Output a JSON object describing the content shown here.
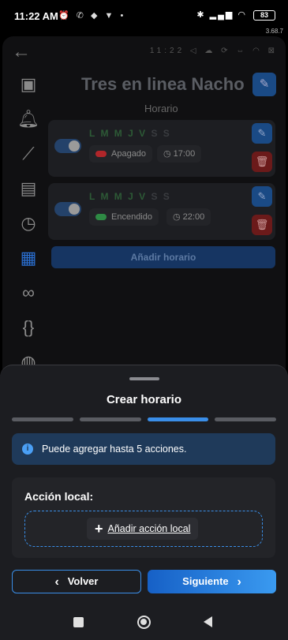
{
  "status_bar": {
    "time": "11:22 AM",
    "battery": "83",
    "version": "3.68.7"
  },
  "background": {
    "mini_time": "11:22",
    "device_title": "Tres en linea Nacho",
    "subtitle": "Horario",
    "add_schedule_label": "Añadir horario",
    "schedules": [
      {
        "days_on": "L M M J V",
        "days_off": "S S",
        "state": "Apagado",
        "state_color": "#b0262a",
        "time": "17:00",
        "enabled": true
      },
      {
        "days_on": "L M M J V",
        "days_off": "S S",
        "state": "Encendido",
        "state_color": "#2e8a44",
        "time": "22:00",
        "enabled": true
      }
    ]
  },
  "sheet": {
    "title": "Crear horario",
    "steps_total": 4,
    "current_step": 3,
    "info_text": "Puede agregar hasta 5 acciones.",
    "action_title": "Acción local:",
    "add_local_label": "Añadir acción local",
    "back_label": "Volver",
    "next_label": "Siguiente",
    "accent_color": "#3a8ee8"
  }
}
